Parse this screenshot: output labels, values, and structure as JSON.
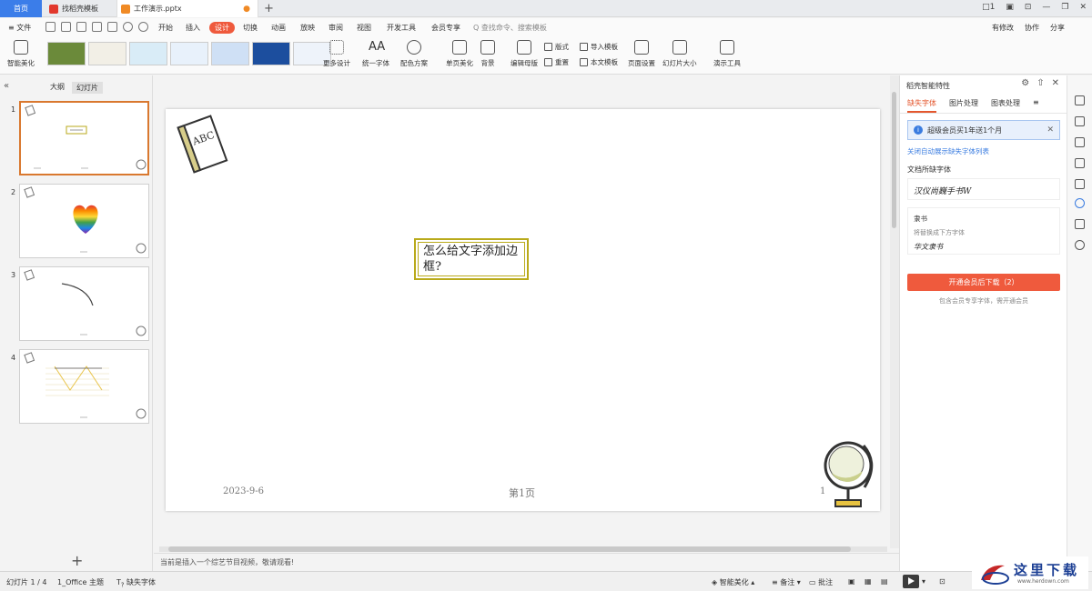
{
  "tabs": {
    "home": "首页",
    "template": "找稻壳模板",
    "document": "工作演示.pptx",
    "modified_dot": "●",
    "new_tab": "+"
  },
  "window_controls": [
    "□1",
    "▣",
    "⊡",
    "—",
    "❐",
    "✕"
  ],
  "menu": {
    "file": "≡ 文件",
    "items": [
      "开始",
      "插入",
      "设计",
      "切换",
      "动画",
      "放映",
      "审阅",
      "视图",
      "开发工具",
      "会员专享"
    ],
    "active": "设计",
    "search_placeholder": "Q 查找命令、搜索模板",
    "right": [
      "有修改",
      "协作",
      "分享"
    ]
  },
  "toolbar": {
    "smart_beautify": "智能美化",
    "more_design": "更多设计",
    "unify_font": "统一字体",
    "color_scheme": "配色方案",
    "single_page_beautify": "单页美化",
    "background": "背景",
    "edit_master": "编辑母版",
    "layout": "版式",
    "reset": "重置",
    "import_template": "导入模板",
    "body_template": "本文模板",
    "page_setup": "页面设置",
    "slide_size": "幻灯片大小",
    "presentation_tools": "演示工具"
  },
  "left_pane": {
    "collapse": "«",
    "tab_outline": "大纲",
    "tab_slides": "幻灯片",
    "slide_numbers": [
      "1",
      "2",
      "3",
      "4"
    ],
    "add_slide": "+"
  },
  "slide": {
    "text": "怎么给文字添加边框?",
    "date": "2023-9-6",
    "page_label": "第1页",
    "page_number": "1",
    "book_label": "ABC"
  },
  "notes_bar": "当前是插入一个综艺节目视频，敬请观看!",
  "right_panel": {
    "title": "稻壳智能特性",
    "tabs": [
      "缺失字体",
      "图片处理",
      "图表处理"
    ],
    "active_tab": "缺失字体",
    "banner": "超级会员买1年送1个月",
    "link": "关闭自动展示缺失字体列表",
    "section_label": "文档所缺字体",
    "font1_sample": "汉仪尚巍手书W",
    "font2_name": "隶书",
    "font2_hint": "将替换成下方字体",
    "font2_sample": "华文隶书",
    "button": "开通会员后下载（2）",
    "note": "包含会员专享字体，需开通会员"
  },
  "statusbar": {
    "slide_info": "幻灯片 1 / 4",
    "theme": "1_Office 主题",
    "missing_font": "缺失字体",
    "smart_beautify": "智能美化",
    "notes": "备注",
    "comments": "批注"
  },
  "watermark": {
    "text": "这里下载",
    "url": "www.herdown.com"
  },
  "colors": {
    "accent": "#ef5a3d",
    "tab_home": "#3b7de9",
    "frame": "#b9aa1b",
    "slide_border_active": "#d9782f"
  }
}
